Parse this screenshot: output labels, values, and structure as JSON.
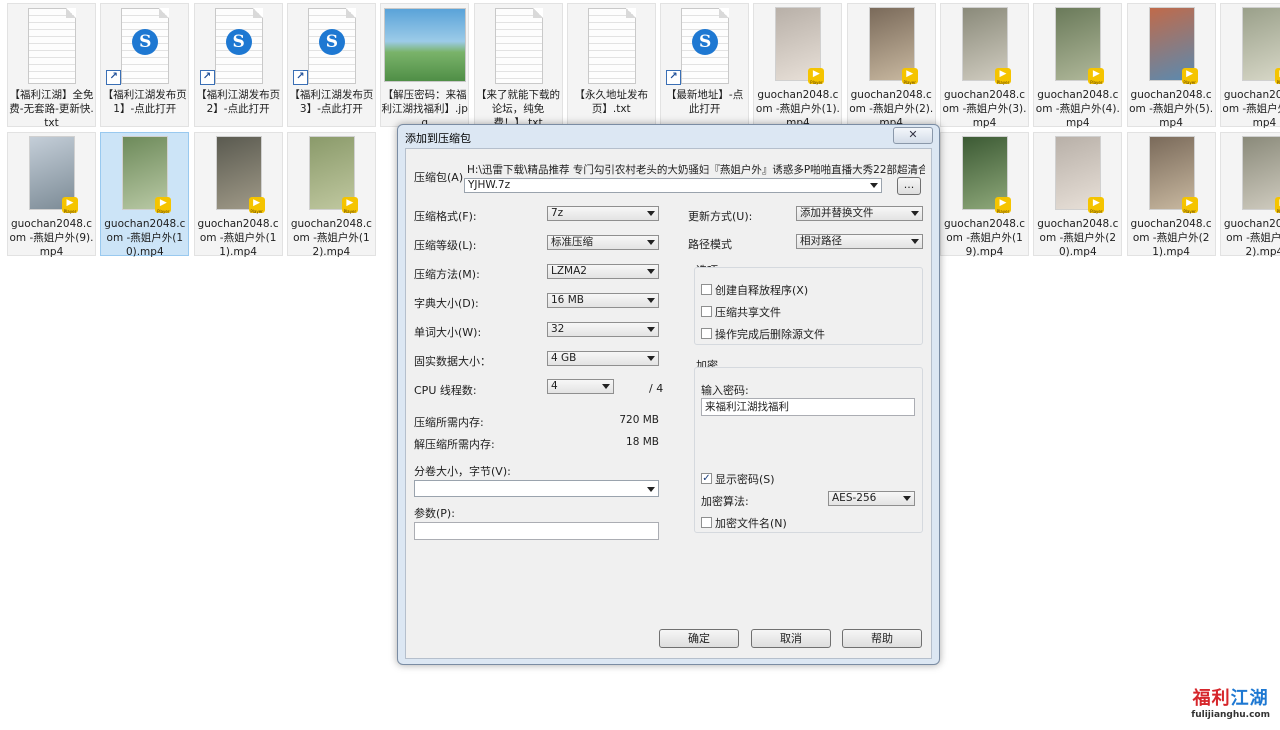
{
  "desktop": {
    "row1": [
      {
        "caption": "【福利江湖】全免费-无套路-更新快.txt",
        "kind": "doc"
      },
      {
        "caption": "【福利江湖发布页1】-点此打开",
        "kind": "link"
      },
      {
        "caption": "【福利江湖发布页2】-点此打开",
        "kind": "link"
      },
      {
        "caption": "【福利江湖发布页3】-点此打开",
        "kind": "link"
      },
      {
        "caption": "【解压密码：来福利江湖找福利】.jpg",
        "kind": "image"
      },
      {
        "caption": "【来了就能下载的论坛，纯免费！】.txt",
        "kind": "doc"
      },
      {
        "caption": "【永久地址发布页】.txt",
        "kind": "doc"
      },
      {
        "caption": "【最新地址】-点此打开",
        "kind": "link"
      },
      {
        "caption": "guochan2048.com -燕姐户外(1).mp4",
        "kind": "video"
      },
      {
        "caption": "guochan2048.com -燕姐户外(2).mp4",
        "kind": "video"
      },
      {
        "caption": "guochan2048.com -燕姐户外(3).mp4",
        "kind": "video"
      },
      {
        "caption": "guochan2048.com -燕姐户外(4).mp4",
        "kind": "video"
      },
      {
        "caption": "guochan2048.com -燕姐户外(5).mp4",
        "kind": "video"
      },
      {
        "caption": "guochan2048.com -燕姐户外(6).mp4",
        "kind": "video"
      }
    ],
    "row2": [
      {
        "caption": "guochan2048.com -燕姐户外(9).mp4",
        "kind": "video"
      },
      {
        "caption": "guochan2048.com -燕姐户外(10).mp4",
        "kind": "video",
        "selected": true
      },
      {
        "caption": "guochan2048.com -燕姐户外(11).mp4",
        "kind": "video"
      },
      {
        "caption": "guochan2048.com -燕姐户外(12).mp4",
        "kind": "video"
      },
      {
        "caption": "guochan2048.com -燕姐户外(19).mp4",
        "kind": "video"
      },
      {
        "caption": "guochan2048.com -燕姐户外(20).mp4",
        "kind": "video"
      },
      {
        "caption": "guochan2048.com -燕姐户外(21).mp4",
        "kind": "video"
      },
      {
        "caption": "guochan2048.com -燕姐户外(22).mp4",
        "kind": "video"
      }
    ],
    "icons": {
      "link_glyph": "S",
      "shortcut_glyph": "↗",
      "player_glyph": "▶",
      "player_label": "Player"
    }
  },
  "dialog": {
    "title": "添加到压缩包",
    "close_glyph": "✕",
    "archive_label": "压缩包(A)",
    "archive_path": "H:\\迅雷下载\\精品推荐 专门勾引农村老头的大奶骚妇『燕姐户外』诱惑多P啪啪直播大秀22部超清合集",
    "archive_name": "YJHW.7z",
    "browse_label": "...",
    "left": [
      {
        "label": "压缩格式(F):",
        "value": "7z"
      },
      {
        "label": "压缩等级(L):",
        "value": "标准压缩"
      },
      {
        "label": "压缩方法(M):",
        "value": "LZMA2"
      },
      {
        "label": "字典大小(D):",
        "value": "16 MB"
      },
      {
        "label": "单词大小(W):",
        "value": "32"
      },
      {
        "label": "固实数据大小：",
        "value": "4 GB"
      }
    ],
    "cpu_label": "CPU 线程数:",
    "cpu_value": "4",
    "cpu_total": "/ 4",
    "mem_compress_label": "压缩所需内存:",
    "mem_compress_value": "720 MB",
    "mem_decompress_label": "解压缩所需内存:",
    "mem_decompress_value": "18 MB",
    "split_label": "分卷大小，字节(V):",
    "split_value": "",
    "params_label": "参数(P):",
    "params_value": "",
    "update_label": "更新方式(U):",
    "update_value": "添加并替换文件",
    "path_label": "路径模式",
    "path_value": "相对路径",
    "options_title": "选项",
    "options": [
      {
        "label": "创建自释放程序(X)",
        "checked": false
      },
      {
        "label": "压缩共享文件",
        "checked": false
      },
      {
        "label": "操作完成后删除源文件",
        "checked": false
      }
    ],
    "encrypt_title": "加密",
    "password_label": "输入密码:",
    "password_value": "来福利江湖找福利",
    "show_password_label": "显示密码(S)",
    "show_password_checked": true,
    "algo_label": "加密算法:",
    "algo_value": "AES-256",
    "encrypt_names_label": "加密文件名(N)",
    "encrypt_names_checked": false,
    "ok_label": "确定",
    "cancel_label": "取消",
    "help_label": "帮助"
  },
  "watermark": {
    "title_red": "福利",
    "title_blue": "江湖",
    "url": "fulijianghu.com"
  }
}
